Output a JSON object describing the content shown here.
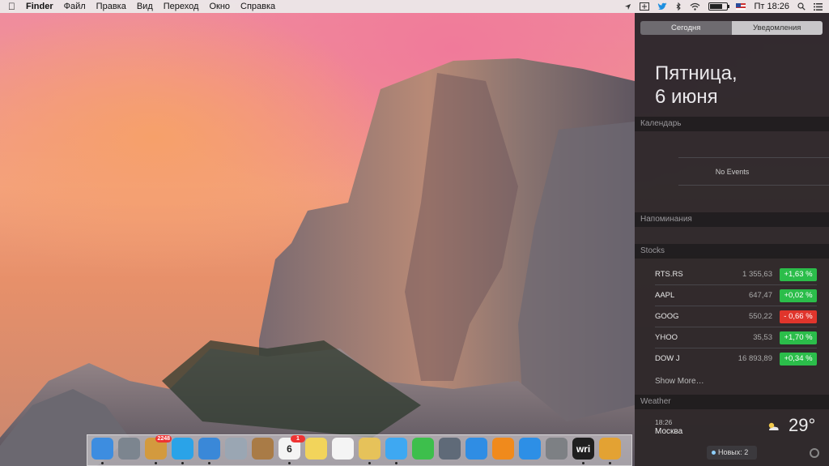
{
  "menubar": {
    "apple_icon": "apple-icon",
    "app_name": "Finder",
    "menus": [
      "Файл",
      "Правка",
      "Вид",
      "Переход",
      "Окно",
      "Справка"
    ],
    "clock": "Пт 18:26",
    "battery_level": 0.75,
    "status_icons": [
      "location-icon",
      "fork-icon",
      "twitter-icon",
      "bluetooth-icon",
      "wifi-icon",
      "battery-icon",
      "flag-icon",
      "search-icon",
      "list-icon"
    ]
  },
  "notification_center": {
    "tabs": {
      "today": "Сегодня",
      "notifications": "Уведомления"
    },
    "date_line1": "Пятница,",
    "date_line2": "6 июня",
    "calendar_header": "Календарь",
    "no_events": "No Events",
    "reminders_header": "Напоминания",
    "stocks_header": "Stocks",
    "stocks": [
      {
        "symbol": "RTS.RS",
        "price": "1 355,63",
        "change": "+1,63 %",
        "color": "#2bbd4a"
      },
      {
        "symbol": "AAPL",
        "price": "647,47",
        "change": "+0,02 %",
        "color": "#2bbd4a"
      },
      {
        "symbol": "GOOG",
        "price": "550,22",
        "change": "- 0,66 %",
        "color": "#e0352c"
      },
      {
        "symbol": "YHOO",
        "price": "35,53",
        "change": "+1,70 %",
        "color": "#2bbd4a"
      },
      {
        "symbol": "DOW J",
        "price": "16 893,89",
        "change": "+0,34 %",
        "color": "#2bbd4a"
      }
    ],
    "show_more": "Show More…",
    "weather_header": "Weather",
    "weather_time": "18:26",
    "weather_city": "Москва",
    "weather_temp": "29°",
    "new_badge": "Новых: 2"
  },
  "dock": {
    "items": [
      {
        "name": "finder",
        "label": "",
        "color": "#3d8de0",
        "badge": "",
        "running": true
      },
      {
        "name": "launchpad",
        "label": "",
        "color": "#7c858f",
        "badge": "",
        "running": false
      },
      {
        "name": "archive",
        "label": "",
        "color": "#d39a3e",
        "badge": "2248",
        "running": true
      },
      {
        "name": "twitter",
        "label": "",
        "color": "#2aa3e8",
        "badge": "",
        "running": true
      },
      {
        "name": "safari",
        "label": "",
        "color": "#3a88d8",
        "badge": "",
        "running": true
      },
      {
        "name": "preview",
        "label": "",
        "color": "#9aa6b3",
        "badge": "",
        "running": false
      },
      {
        "name": "contacts",
        "label": "",
        "color": "#a97b46",
        "badge": "",
        "running": false
      },
      {
        "name": "calendar",
        "label": "6",
        "color": "#f4f4f4",
        "badge": "1",
        "running": true
      },
      {
        "name": "notes",
        "label": "",
        "color": "#f2d45b",
        "badge": "",
        "running": false
      },
      {
        "name": "reminders",
        "label": "",
        "color": "#f4f4f4",
        "badge": "",
        "running": false
      },
      {
        "name": "photos",
        "label": "",
        "color": "#e6c25a",
        "badge": "",
        "running": true
      },
      {
        "name": "messages",
        "label": "",
        "color": "#3ea8f2",
        "badge": "",
        "running": true
      },
      {
        "name": "facetime",
        "label": "",
        "color": "#3dbf4c",
        "badge": "",
        "running": false
      },
      {
        "name": "image-capture",
        "label": "",
        "color": "#5f6a78",
        "badge": "",
        "running": false
      },
      {
        "name": "itunes",
        "label": "",
        "color": "#2f8de4",
        "badge": "",
        "running": false
      },
      {
        "name": "ibooks",
        "label": "",
        "color": "#f08a1c",
        "badge": "",
        "running": false
      },
      {
        "name": "app-store",
        "label": "",
        "color": "#2d8fe6",
        "badge": "",
        "running": false
      },
      {
        "name": "system-preferences",
        "label": "",
        "color": "#7d8084",
        "badge": "",
        "running": false
      },
      {
        "name": "writer",
        "label": "wri",
        "color": "#1f1f1f",
        "badge": "",
        "running": true
      },
      {
        "name": "pixelmator",
        "label": "",
        "color": "#e3a233",
        "badge": "",
        "running": true
      }
    ]
  }
}
